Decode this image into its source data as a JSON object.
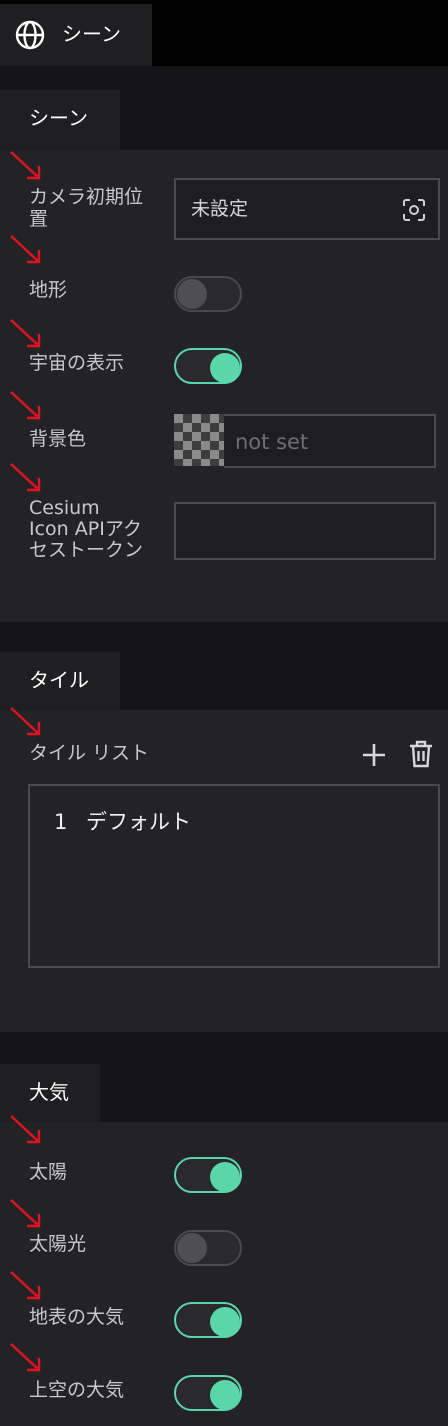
{
  "header": {
    "title": "シーン",
    "icon": "globe-icon"
  },
  "scene": {
    "tab_label": "シーン",
    "camera_label": "カメラ初期位置置",
    "camera_label_line1": "カメラ初期位",
    "camera_label_line2": "置",
    "camera_value": "未設定",
    "terrain_label": "地形",
    "terrain_on": false,
    "space_label": "宇宙の表示",
    "space_on": true,
    "bg_color_label": "背景色",
    "bg_color_placeholder": "not set",
    "token_label_line1": "Cesium",
    "token_label_line2": "Icon APIアク",
    "token_label_line3": "セストークン",
    "token_value": ""
  },
  "tiles": {
    "tab_label": "タイル",
    "list_label": "タイル リスト",
    "items": [
      {
        "index": "1",
        "name": "デフォルト"
      }
    ]
  },
  "atmosphere": {
    "tab_label": "大気",
    "sun_label": "太陽",
    "sun_on": true,
    "sunlight_label": "太陽光",
    "sunlight_on": false,
    "ground_atmo_label": "地表の大気",
    "ground_atmo_on": true,
    "sky_atmo_label": "上空の大気",
    "sky_atmo_on": true
  },
  "colors": {
    "accent": "#5ad6a8",
    "annotation_arrow": "#e0141e"
  }
}
